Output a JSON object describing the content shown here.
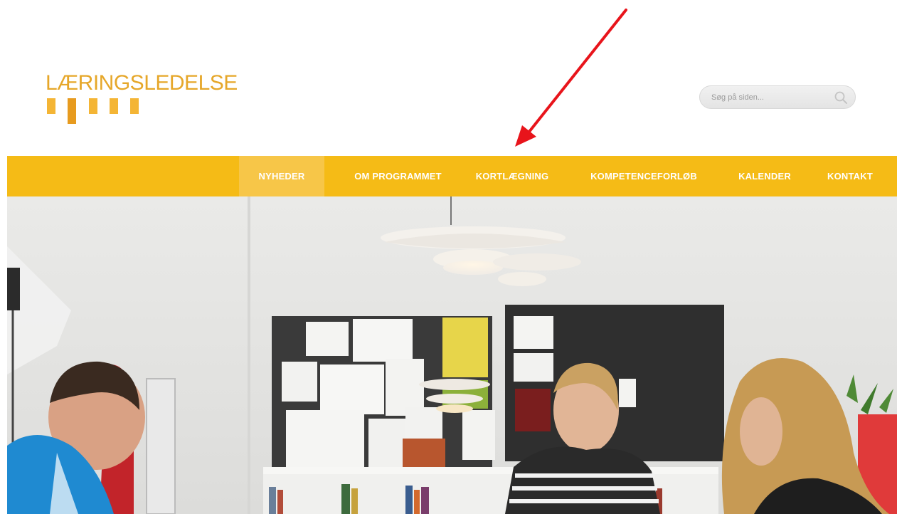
{
  "logo": {
    "text": "LÆRINGSLEDELSE"
  },
  "search": {
    "placeholder": "Søg på siden..."
  },
  "nav": {
    "items": [
      {
        "label": "NYHEDER",
        "active": true
      },
      {
        "label": "OM PROGRAMMET",
        "active": false
      },
      {
        "label": "KORTLÆGNING",
        "active": false
      },
      {
        "label": "KOMPETENCEFORLØB",
        "active": false
      },
      {
        "label": "KALENDER",
        "active": false
      },
      {
        "label": "KONTAKT",
        "active": false
      }
    ]
  },
  "colors": {
    "brand": "#f5bb16",
    "logo": "#e6a72a",
    "annotation_arrow": "#e8141b"
  },
  "hero": {
    "image": "office-photo-people-working"
  }
}
